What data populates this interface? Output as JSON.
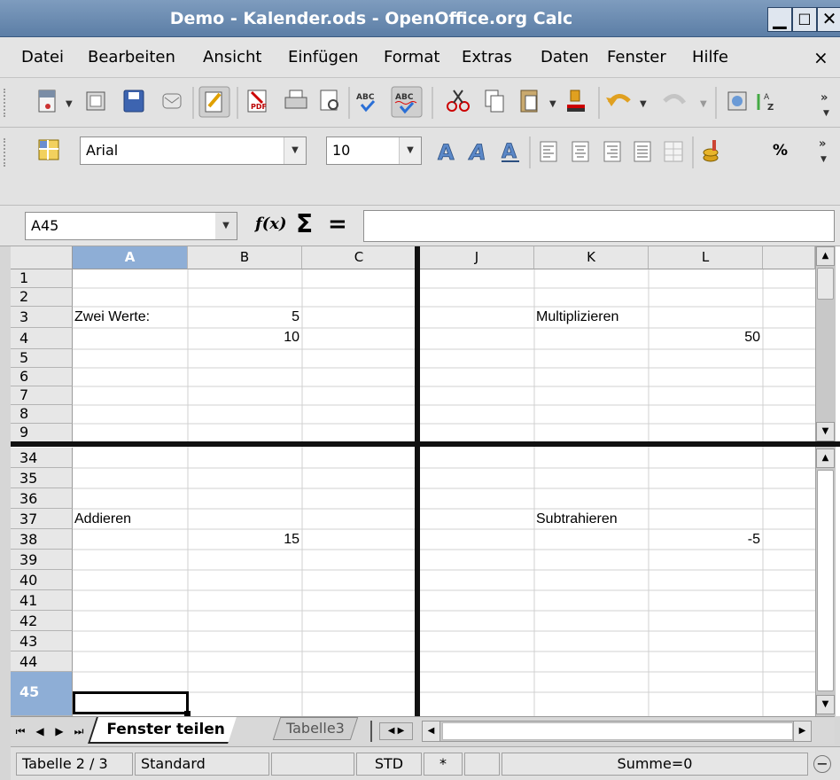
{
  "window": {
    "title": "Demo - Kalender.ods - OpenOffice.org Calc"
  },
  "menu": [
    "Datei",
    "Bearbeiten",
    "Ansicht",
    "Einfügen",
    "Format",
    "Extras",
    "Daten",
    "Fenster",
    "Hilfe"
  ],
  "menu_close": "×",
  "format_toolbar": {
    "font": "Arial",
    "size": "10",
    "percent": "%"
  },
  "formula": {
    "cellref": "A45",
    "fx": "f(x)",
    "sigma": "Σ",
    "equals": "=",
    "value": ""
  },
  "columns_left": [
    "A",
    "B",
    "C"
  ],
  "columns_right": [
    "J",
    "K",
    "L"
  ],
  "rows_top": [
    "1",
    "2",
    "3",
    "4",
    "5",
    "6",
    "7",
    "8",
    "9"
  ],
  "rows_bottom": [
    "34",
    "35",
    "36",
    "37",
    "38",
    "39",
    "40",
    "41",
    "42",
    "43",
    "44",
    "45"
  ],
  "cells": {
    "A3": "Zwei Werte:",
    "B3": "5",
    "B4": "10",
    "K3": "Multiplizieren",
    "L4": "50",
    "A37": "Addieren",
    "B38": "15",
    "K37": "Subtrahieren",
    "L38": "-5"
  },
  "sheet_tabs": [
    {
      "label": "Fenster teilen",
      "active": true
    },
    {
      "label": "Tabelle3",
      "active": false
    }
  ],
  "status": {
    "sheet": "Tabelle 2 / 3",
    "style": "Standard",
    "mode": "STD",
    "modified": "*",
    "sum": "Summe=0"
  }
}
